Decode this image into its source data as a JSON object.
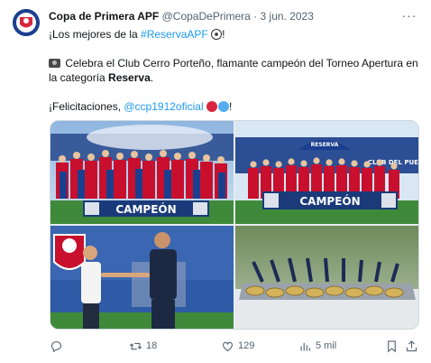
{
  "author": {
    "name": "Copa de Primera APF",
    "handle": "@CopaDePrimera",
    "separator": "·",
    "date": "3 jun. 2023"
  },
  "more_label": "···",
  "body": {
    "line1_prefix": "¡Los mejores de la ",
    "hashtag": "#ReservaAPF",
    "line1_suffix": "!",
    "line2": "Celebra el Club Cerro Porteño, flamante campeón del Torneo Apertura en la categoría ",
    "line2_bold": "Reserva",
    "line2_end": ".",
    "line3_prefix": "¡Felicitaciones, ",
    "mention": "@ccp1912oficial",
    "line3_suffix": "!"
  },
  "media": {
    "banner_text_1": "CAMPEÓN",
    "banner_text_2": "CAMPEÓN",
    "sign_text": "RESERVA",
    "sign_text_2": "CLUB DEL PUE"
  },
  "actions": {
    "reply_count": "",
    "retweet_count": "18",
    "like_count": "129",
    "views_count": "5 mil"
  },
  "colors": {
    "link": "#1d9bf0",
    "secondary_text": "#536471",
    "brand_blue": "#1b3f8f",
    "brand_red": "#d7263d"
  },
  "icons": [
    "apf-logo-icon",
    "more-icon",
    "camera-icon",
    "soccer-ball-icon",
    "red-circle-icon",
    "blue-circle-icon",
    "reply-icon",
    "retweet-icon",
    "like-icon",
    "views-icon",
    "bookmark-icon",
    "share-icon"
  ]
}
